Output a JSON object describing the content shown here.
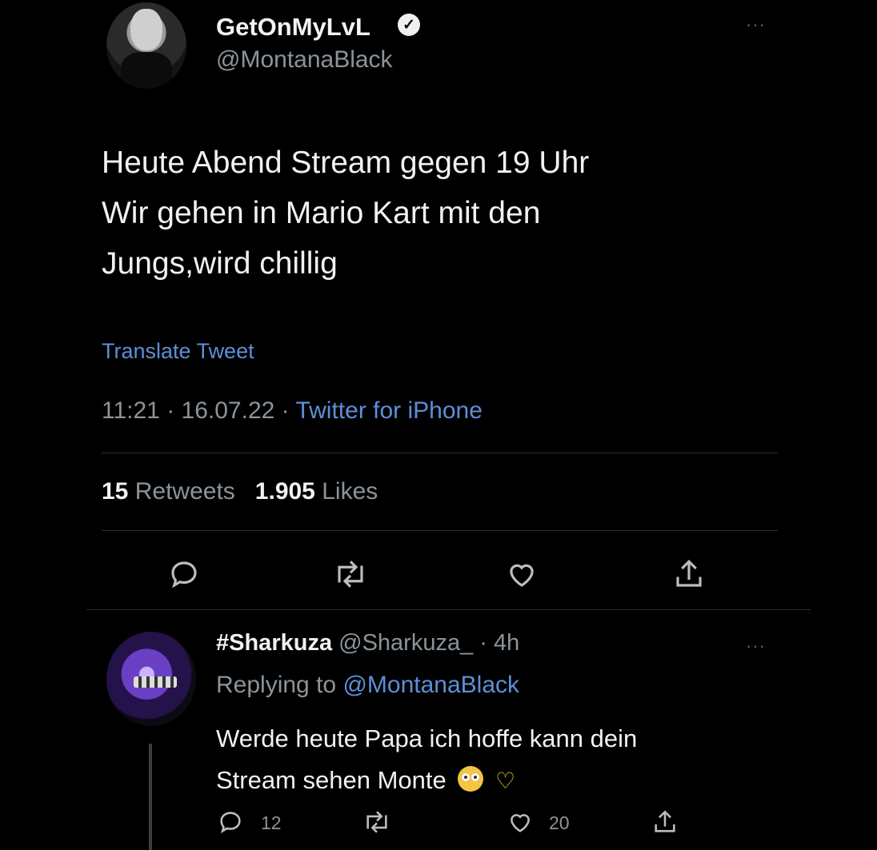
{
  "tweet": {
    "display_name": "GetOnMyLvL",
    "handle": "@MontanaBlack",
    "more": "···",
    "text_lines": [
      "Heute Abend Stream gegen 19 Uhr",
      "Wir gehen in Mario Kart mit den",
      "Jungs,wird chillig"
    ],
    "translate": "Translate Tweet",
    "time": "11:21",
    "date": "16.07.22",
    "separator": "·",
    "source": "Twitter for iPhone",
    "retweets_count": "15",
    "retweets_label": "Retweets",
    "likes_count": "1.905",
    "likes_label": "Likes"
  },
  "reply": {
    "name": "#Sharkuza",
    "handle": "@Sharkuza_",
    "age": "4h",
    "separator": "·",
    "more": "···",
    "replying_prefix": "Replying to",
    "replying_to": "@MontanaBlack",
    "text_line1": "Werde heute Papa ich hoffe kann dein",
    "text_line2": "Stream sehen Monte",
    "reply_count": "12",
    "like_count": "20"
  },
  "colors": {
    "background": "#000000",
    "link": "#5d8fd8",
    "muted": "#8b949a",
    "text": "#f1f1f1"
  },
  "icons": [
    "comment-icon",
    "retweet-icon",
    "heart-icon",
    "share-icon",
    "verified-icon",
    "more-icon"
  ]
}
